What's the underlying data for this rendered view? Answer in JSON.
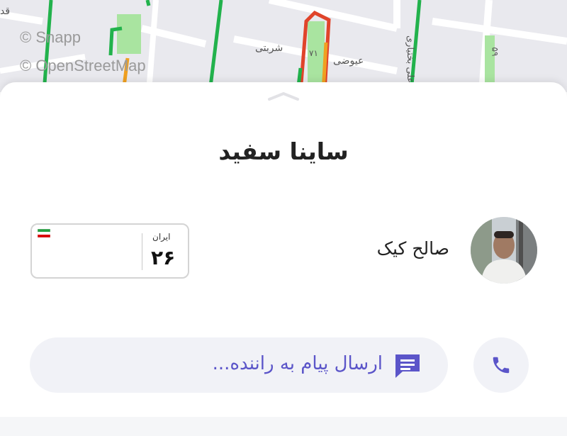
{
  "map": {
    "attribution_snapp": "© Snapp",
    "attribution_osm": "© OpenStreetMap",
    "street_labels": [
      "شربتی",
      "عیوضی",
      "علی بختیاری",
      "۷۱",
      "۵۹",
      "قد"
    ]
  },
  "ride": {
    "car_title": "ساینا سفید",
    "driver_name": "صالح کیک",
    "plate": {
      "country_label": "ایران",
      "region_number": "۲۶"
    }
  },
  "actions": {
    "message_placeholder": "ارسال پیام به راننده...",
    "message_icon": "chat-icon",
    "call_icon": "phone-icon"
  },
  "colors": {
    "accent": "#5b55c9",
    "traffic_green": "#22b24c",
    "traffic_orange": "#f0a020",
    "traffic_red": "#e0442a",
    "park_green": "#a9e4a0"
  }
}
